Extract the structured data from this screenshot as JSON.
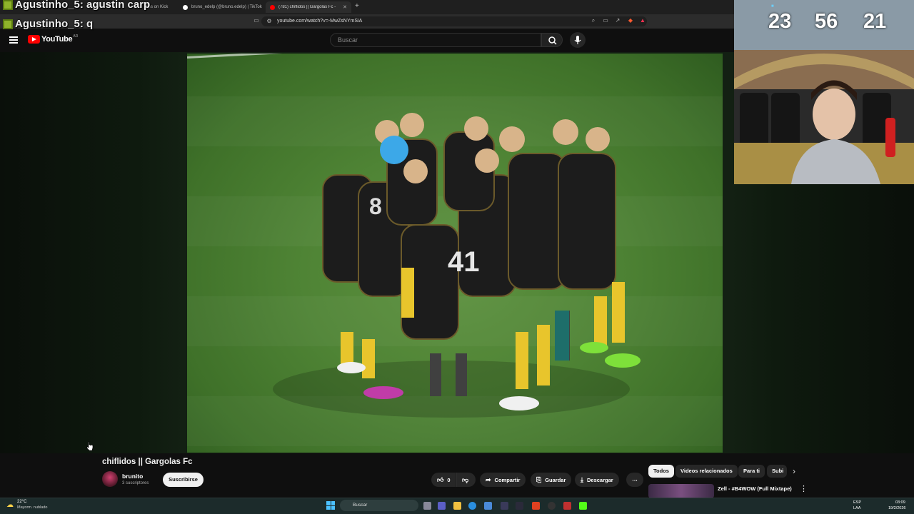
{
  "browser": {
    "tabs": [
      {
        "label": "clips on Kick",
        "color": "#53fc18"
      },
      {
        "label": "bruno_edelp (@bruno.edelp) | TikTok",
        "color": "#ffffff"
      },
      {
        "label": "(781) chiflidos || Gargolas Fc - Yo",
        "color": "#ff0000"
      }
    ],
    "new_tab": "+",
    "url": "youtube.com/watch?v=-MwZsNYmSiA"
  },
  "chat": [
    {
      "user": "Agustinho_5",
      "message": "agustin carp"
    },
    {
      "user": "Agustinho_5",
      "message": "q"
    }
  ],
  "youtube": {
    "logo_text": "YouTube",
    "logo_country": "AR",
    "search_placeholder": "Buscar"
  },
  "video": {
    "title": "chiflidos || Gargolas Fc",
    "channel": "brunito",
    "subscribers": "3 suscriptores",
    "subscribe_label": "Suscribirse",
    "likes": "0",
    "share_label": "Compartir",
    "save_label": "Guardar",
    "download_label": "Descargar",
    "more": "⋯"
  },
  "sidebar": {
    "chips": [
      "Todos",
      "Videos relacionados",
      "Para ti",
      "Subi"
    ],
    "next": "›",
    "related": {
      "title": "Zell - #B4WOW (Full Mixtape)",
      "more": "⋮"
    }
  },
  "webcam": {
    "scores": [
      "23",
      "56",
      "21"
    ]
  },
  "taskbar": {
    "weather_temp": "22°C",
    "weather_desc": "Mayorm. nublado",
    "search_label": "Buscar",
    "lang1": "ESP",
    "lang2": "LAA",
    "time": "03:09",
    "date": "19/2/2026"
  }
}
